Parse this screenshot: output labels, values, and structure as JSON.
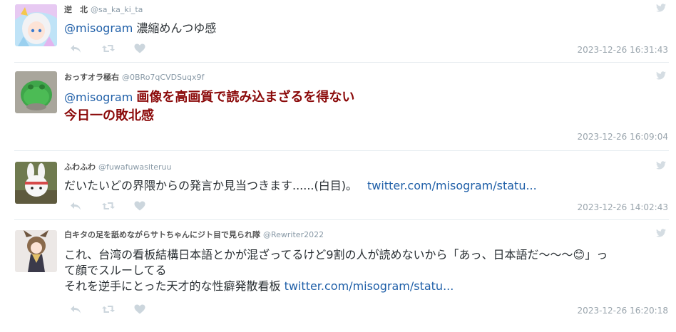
{
  "tweets": [
    {
      "name": "逆　北",
      "handle": "@sa_ka_ki_ta",
      "mention": "@misogram",
      "text": " 濃縮めんつゆ感",
      "timestamp": "2023-12-26 16:31:43"
    },
    {
      "name": "おっすオラ極右",
      "handle": "@0BRo7qCVDSuqx9f",
      "mention": "@misogram",
      "text_line1": "画像を高画質で読み込まざるを得ない",
      "text_line2": "今日一の敗北感",
      "timestamp": "2023-12-26 16:09:04"
    },
    {
      "name": "ふわふわ",
      "handle": "@fuwafuwasiteruu",
      "text": "だいたいどの界隈からの発言か見当つきます......(白目)。",
      "link": "twitter.com/misogram/statu...",
      "timestamp": "2023-12-26 14:02:43"
    },
    {
      "name": "白キタの足を舐めながらサトちゃんにジト目で見られ隊",
      "handle": "@Rewriter2022",
      "text_line1": "これ、台湾の看板結構日本語とかが混ざってるけど9割の人が読めないから「あっ、日本語だ〜〜〜😊」っ",
      "text_line2": "て顔でスルーしてる",
      "text_line3": "それを逆手にとった天才的な性癖発散看板 ",
      "link": "twitter.com/misogram/statu...",
      "timestamp": "2023-12-26 16:20:18"
    }
  ],
  "icons": [
    "reply-icon",
    "retweet-icon",
    "like-icon",
    "twitter-bird-icon"
  ],
  "colors": {
    "link": "#1f5fa8",
    "emphasis": "#8b0a0a",
    "muted": "#9aa5ad"
  }
}
